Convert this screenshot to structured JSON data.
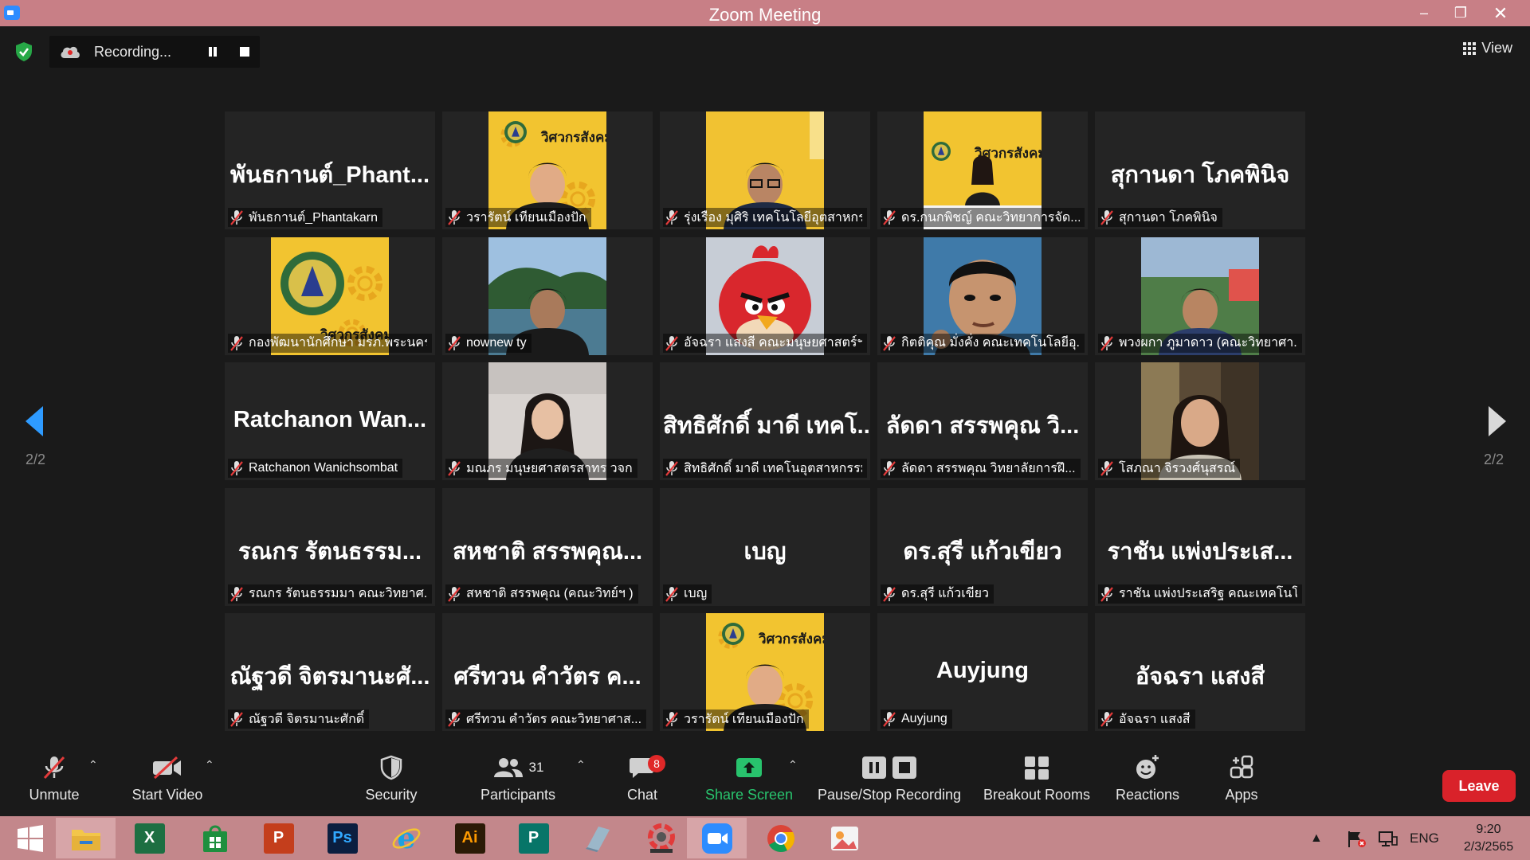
{
  "window": {
    "title": "Zoom Meeting"
  },
  "recording": {
    "label": "Recording..."
  },
  "view": {
    "label": "View"
  },
  "page": {
    "left": "2/2",
    "right": "2/2"
  },
  "tiles": [
    {
      "big": "พันธกานต์_Phant...",
      "name": "พันธกานต์_Phantakarn"
    },
    {
      "big": "",
      "name": "วรารัตน์ เทียนเมืองปัก",
      "photo": "poster-woman"
    },
    {
      "big": "",
      "name": "รุ่งเรือง มุศิริ เทคโนโลยีอุตสาหกร...",
      "photo": "man-glasses"
    },
    {
      "big": "",
      "name": "ดร.กนกพิชญ์ คณะวิทยาการจัด...",
      "photo": "poster-woman2"
    },
    {
      "big": "สุกานดา โภคพินิจ",
      "name": "สุกานดา โภคพินิจ"
    },
    {
      "big": "",
      "name": "กองพัฒนานักศึกษา มรภ.พระนคร",
      "photo": "emblem"
    },
    {
      "big": "",
      "name": "nownew ty",
      "photo": "lake"
    },
    {
      "big": "",
      "name": "อัจฉรา แสงสี คณะมนุษยศาสตร์ฯ",
      "photo": "red-bird"
    },
    {
      "big": "",
      "name": "กิตติคุณ มั่งคั่ง คณะเทคโนโลยีอุ...",
      "photo": "cartoon-man"
    },
    {
      "big": "",
      "name": "พวงผกา ภูมาดาว (คณะวิทยาศา...",
      "photo": "woman-outdoor"
    },
    {
      "big": "Ratchanon Wan...",
      "name": "Ratchanon Wanichsombat"
    },
    {
      "big": "",
      "name": "มณภร มนุษยศาสตรสาทร วจก",
      "photo": "woman-room"
    },
    {
      "big": "สิทธิศักดิ์ มาดี เทคโ...",
      "name": "สิทธิศักดิ์ มาดี เทคโนอุตสาหกรรม"
    },
    {
      "big": "ลัดดา สรรพคุณ วิ...",
      "name": "ลัดดา สรรพคุณ วิทยาลัยการฝึ..."
    },
    {
      "big": "",
      "name": "โสภณา จิรวงศ์นุสรณ์",
      "photo": "woman-portrait"
    },
    {
      "big": "รณกร รัตนธรรม...",
      "name": "รณกร รัตนธรรมมา คณะวิทยาศ..."
    },
    {
      "big": "สหชาติ สรรพคุณ...",
      "name": "สหชาติ สรรพคุณ (คณะวิทย์ฯ )"
    },
    {
      "big": "เบญ",
      "name": "เบญ"
    },
    {
      "big": "ดร.สุรี แก้วเขียว",
      "name": "ดร.สุรี แก้วเขียว"
    },
    {
      "big": "ราชัน แพ่งประเส...",
      "name": "ราชัน แพ่งประเสริฐ คณะเทคโนโล..."
    },
    {
      "big": "ณัฐวดี จิตรมานะศั...",
      "name": "ณัฐวดี จิตรมานะศักดิ์"
    },
    {
      "big": "ศรีทวน คำวัตร ค...",
      "name": "ศรีทวน คำวัตร คณะวิทยาศาส..."
    },
    {
      "big": "",
      "name": "วรารัตน์ เทียนเมืองปัก",
      "photo": "poster-woman"
    },
    {
      "big": "Auyjung",
      "name": "Auyjung"
    },
    {
      "big": "อัจฉรา แสงสี",
      "name": "อัจฉรา แสงสี"
    }
  ],
  "poster_text": "วิศวกรสังคม",
  "toolbar": {
    "unmute": "Unmute",
    "start_video": "Start Video",
    "security": "Security",
    "participants": "Participants",
    "participants_count": "31",
    "chat": "Chat",
    "chat_badge": "8",
    "share_screen": "Share Screen",
    "pause_stop": "Pause/Stop Recording",
    "breakout": "Breakout Rooms",
    "reactions": "Reactions",
    "apps": "Apps",
    "leave": "Leave"
  },
  "taskbar": {
    "apps": [
      {
        "icon": "start-icon"
      },
      {
        "icon": "file-explorer-icon"
      },
      {
        "icon": "excel-icon",
        "glyph": "X",
        "color": "#1d6f42"
      },
      {
        "icon": "store-icon",
        "color": "#1e8f3e"
      },
      {
        "icon": "powerpoint-icon",
        "glyph": "P",
        "color": "#c43e1c"
      },
      {
        "icon": "photoshop-icon",
        "glyph": "Ps",
        "color": "#0b1e3f"
      },
      {
        "icon": "internet-explorer-icon",
        "glyph": "e",
        "color": "#1ba1e2"
      },
      {
        "icon": "illustrator-icon",
        "glyph": "Ai",
        "color": "#2b1a06"
      },
      {
        "icon": "publisher-icon",
        "glyph": "P",
        "color": "#077568"
      },
      {
        "icon": "notepad-icon",
        "color": "#9bb7c9"
      },
      {
        "icon": "photoscape-icon",
        "color": "#555555"
      },
      {
        "icon": "zoom-icon",
        "color": "#2d8cff"
      },
      {
        "icon": "chrome-icon",
        "color": "#db4437"
      },
      {
        "icon": "image-viewer-icon",
        "color": "#f4f4f4"
      }
    ],
    "language": "ENG",
    "time": "9:20",
    "date": "2/3/2565"
  }
}
